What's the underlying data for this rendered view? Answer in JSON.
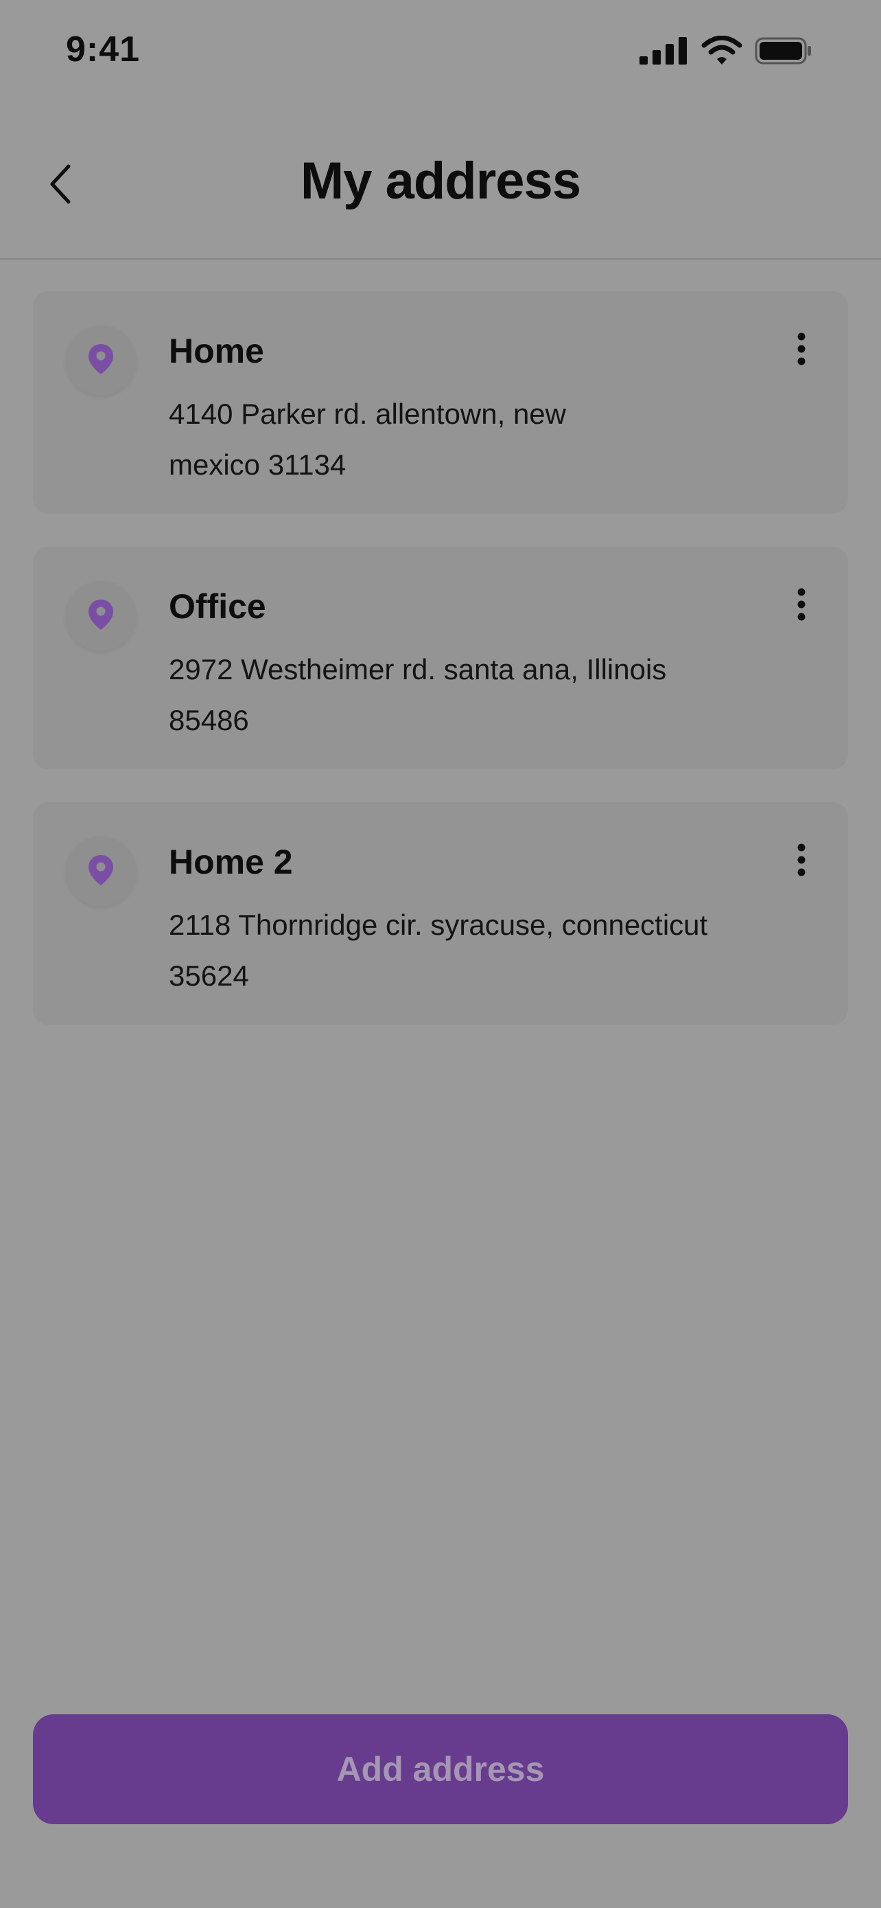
{
  "status_bar": {
    "time": "9:41"
  },
  "header": {
    "title": "My address"
  },
  "addresses": [
    {
      "label": "Home",
      "line1": "4140 Parker rd. allentown, new",
      "line2": "mexico 31134"
    },
    {
      "label": "Office",
      "line1": "2972 Westheimer rd. santa ana, Illinois",
      "line2": "85486"
    },
    {
      "label": "Home 2",
      "line1": "2118 Thornridge cir. syracuse, connecticut",
      "line2": "35624"
    }
  ],
  "actions": {
    "add_label": "Add address"
  },
  "colors": {
    "accent": "#673b8e",
    "pin": "#7b4ea5",
    "overlay_background": "#9a9a9a"
  }
}
